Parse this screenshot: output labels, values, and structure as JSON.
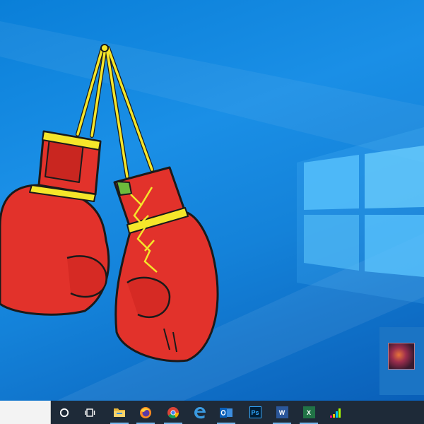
{
  "desktop": {
    "wallpaper": "windows-10-hero",
    "icon": "boxing-gloves-icon",
    "colors": {
      "background": "#1482d9",
      "glove": "#e2322b",
      "lace": "#f5e62a"
    }
  },
  "notification": {
    "thumbnail": "photo-thumbnail"
  },
  "taskbar": {
    "icons": [
      "cortana-icon",
      "task-view-icon",
      "file-explorer-icon",
      "firefox-icon",
      "chrome-icon",
      "edge-icon",
      "outlook-icon",
      "photoshop-icon",
      "word-icon",
      "excel-icon",
      "deezer-icon"
    ],
    "labels": {
      "photoshop": "Ps",
      "word": "W",
      "excel": "X"
    }
  }
}
